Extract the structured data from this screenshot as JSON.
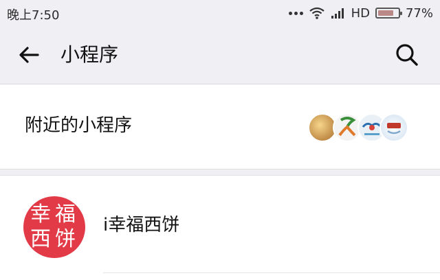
{
  "status_bar": {
    "time": "晚上7:50",
    "network": "HD",
    "battery_percent": "77%",
    "battery_level": 0.77
  },
  "nav": {
    "title": "小程序",
    "back_icon": "arrow-left",
    "search_icon": "magnifier"
  },
  "nearby": {
    "label": "附近的小程序"
  },
  "apps": [
    {
      "name": "i幸福西饼",
      "logo_chars": [
        "幸",
        "福",
        "西",
        "饼"
      ],
      "logo_color": "#e23a47"
    }
  ]
}
